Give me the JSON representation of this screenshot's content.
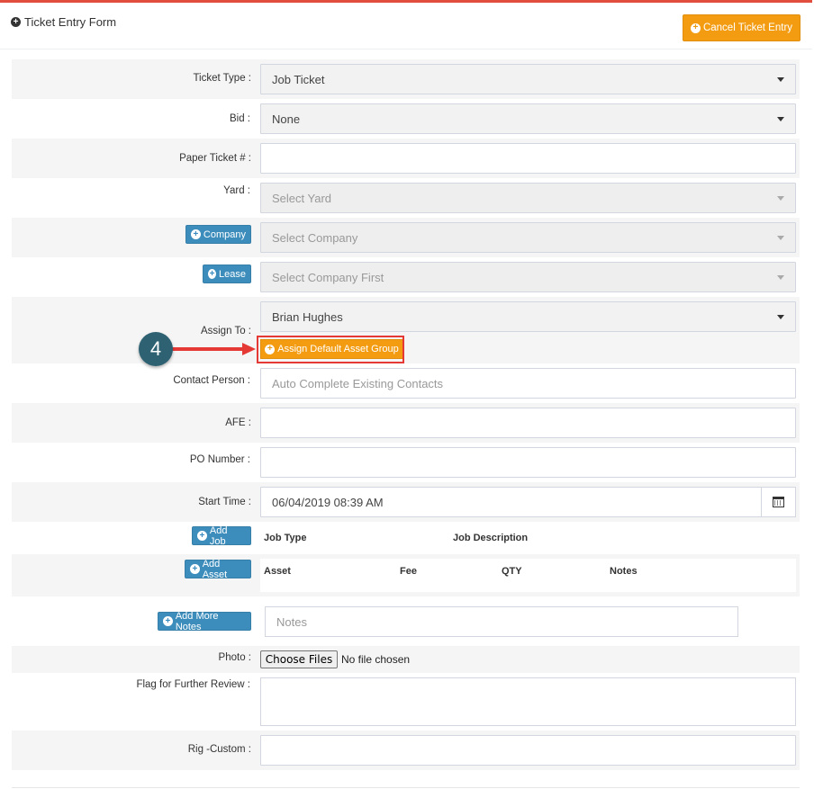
{
  "panel": {
    "title": "Ticket Entry Form",
    "cancel_label": "Cancel Ticket Entry"
  },
  "form": {
    "ticket_type": {
      "label": "Ticket Type :",
      "value": "Job Ticket"
    },
    "bid": {
      "label": "Bid :",
      "value": "None"
    },
    "paper_ticket": {
      "label": "Paper Ticket # :",
      "value": ""
    },
    "yard": {
      "label": "Yard :",
      "placeholder": "Select Yard"
    },
    "company": {
      "button": "Company",
      "placeholder": "Select Company"
    },
    "lease": {
      "button": "Lease",
      "placeholder": "Select Company First"
    },
    "assign_to": {
      "label": "Assign To :",
      "value": "Brian Hughes",
      "assign_button": "Assign Default Asset Group"
    },
    "contact_person": {
      "label": "Contact Person :",
      "placeholder": "Auto Complete Existing Contacts"
    },
    "afe": {
      "label": "AFE :",
      "value": ""
    },
    "po_number": {
      "label": "PO Number :",
      "value": ""
    },
    "start_time": {
      "label": "Start Time :",
      "value": "06/04/2019 08:39 AM"
    },
    "jobs": {
      "button": "Add Job",
      "columns": [
        "Job Type",
        "Job Description"
      ]
    },
    "assets": {
      "button": "Add Asset",
      "columns": [
        "Asset",
        "Fee",
        "QTY",
        "Notes"
      ]
    },
    "notes": {
      "button": "Add More Notes",
      "placeholder": "Notes"
    },
    "photo": {
      "label": "Photo :",
      "button": "Choose Files",
      "status": "No file chosen"
    },
    "flag": {
      "label": "Flag for Further Review :",
      "value": ""
    },
    "rig_custom": {
      "label": "Rig -Custom :",
      "value": ""
    }
  },
  "annotation": {
    "step": "4"
  },
  "colors": {
    "accent_orange": "#f39c12",
    "primary_blue": "#3c8dbc",
    "header_red": "#e24e3d",
    "callout_red": "#e53935",
    "badge_teal": "#2e6273"
  }
}
